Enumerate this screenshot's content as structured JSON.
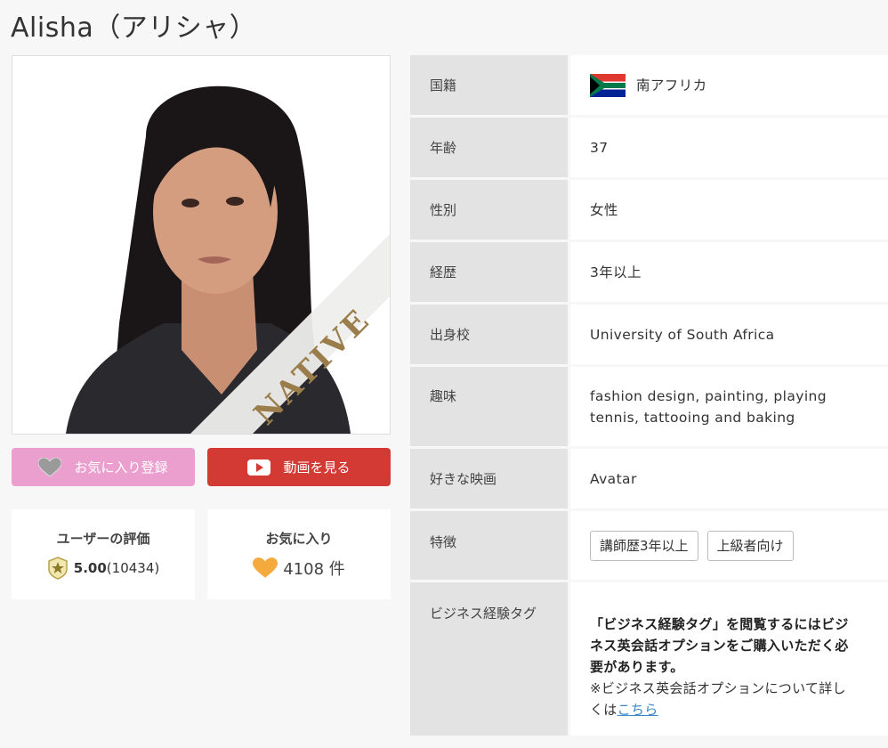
{
  "profile": {
    "title": "Alisha（アリシャ）",
    "badge": "NATIVE"
  },
  "buttons": {
    "favorite_label": "お気に入り登録",
    "video_label": "動画を見る"
  },
  "rating": {
    "title": "ユーザーの評価",
    "score": "5.00",
    "count": "(10434)"
  },
  "favorites": {
    "title": "お気に入り",
    "count": "4108 件"
  },
  "details": [
    {
      "label": "国籍",
      "value": "南アフリカ"
    },
    {
      "label": "年齢",
      "value": "37"
    },
    {
      "label": "性別",
      "value": "女性"
    },
    {
      "label": "経歴",
      "value": "3年以上"
    },
    {
      "label": "出身校",
      "value": "University of South Africa"
    },
    {
      "label": "趣味",
      "value": "fashion design, painting, playing tennis, tattooing and baking"
    },
    {
      "label": "好きな映画",
      "value": "Avatar"
    },
    {
      "label": "特徴",
      "tags": [
        "講師歴3年以上",
        "上級者向け"
      ]
    },
    {
      "label": "ビジネス経験タグ",
      "notice_bold": "「ビジネス経験タグ」を閲覧するにはビジネス英会話オプションをご購入いただく必要があります。",
      "notice_note": "※ビジネス英会話オプションについて詳しくは",
      "notice_link": "こちら"
    }
  ],
  "colors": {
    "favorite_button": "#eb9fcf",
    "video_button": "#d33a33",
    "label_bg": "#e3e3e3",
    "link": "#3a86c8",
    "native_badge": "#9a7d4a"
  },
  "icons": {
    "favorite": "heart-icon",
    "video": "play-icon",
    "rating": "star-badge-icon",
    "favorites_count": "heart-icon",
    "nationality": "south-africa-flag-icon"
  }
}
